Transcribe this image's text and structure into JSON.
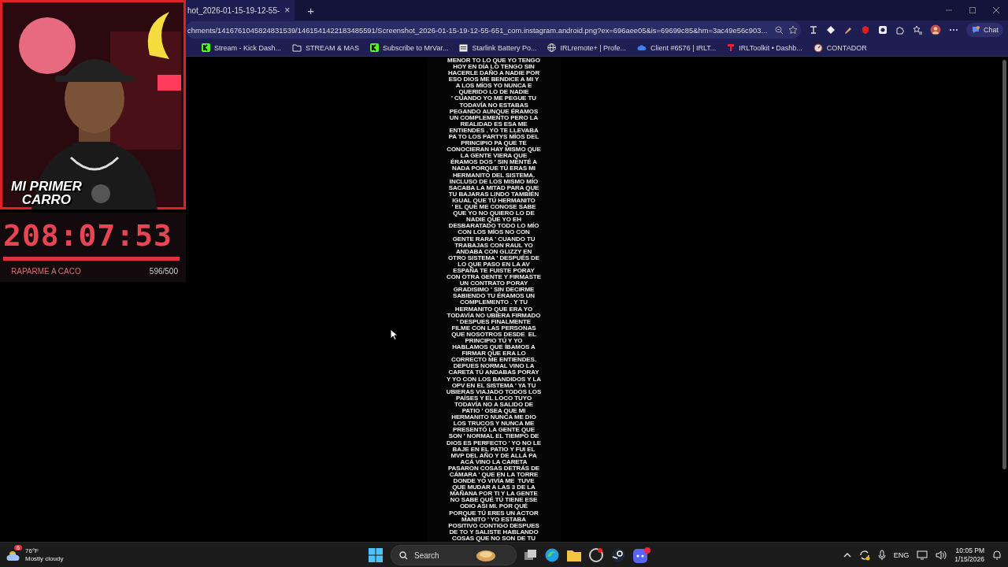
{
  "overlay": {
    "webcam": {
      "caption_lines": [
        "MI PRIMER",
        "CARRO"
      ]
    },
    "timer": {
      "time": "208:07:53",
      "level": 1,
      "goal_label": "RAPARME A CACO",
      "goal_count": "596/500"
    }
  },
  "browser": {
    "tabs": [
      {
        "title": "hot_2026-01-15-19-12-55-",
        "close": "×",
        "selected": true
      }
    ],
    "new_tab": "+",
    "address": "chments/1416761045824831539/1461541422183485591/Screenshot_2026-01-15-19-12-55-651_com.instagram.android.png?ex=696aee05&is=69699c85&hm=3ac49e56c903...",
    "chat_label": "Chat",
    "bookmarks": [
      {
        "label": "Stream - Kick Dash...",
        "kind": "kick"
      },
      {
        "label": "STREAM & MAS",
        "kind": "folder"
      },
      {
        "label": "Subscribe to MrVar...",
        "kind": "kick"
      },
      {
        "label": "Starlink Battery Po...",
        "kind": "page"
      },
      {
        "label": "IRLremote+ | Profe...",
        "kind": "globe"
      },
      {
        "label": "Client #6576 | IRLT...",
        "kind": "cloud"
      },
      {
        "label": "IRLToolkit • Dashb...",
        "kind": "toolkit"
      },
      {
        "label": "CONTADOR",
        "kind": "gauge"
      }
    ],
    "story_lines": [
      "MENOR TO LO QUE YO TENGO",
      "HOY EN DÍA LO TENGO SIN",
      "HACERLE DAÑO A NADIE POR",
      "ESO DIOS ME BENDICE A MI Y",
      "A LOS MÍOS YO NUNCA E",
      "QUERIDO LO DE NADIE",
      "' CUANDO YO ME PEGUE TU",
      "TODAVÍA NO ESTABAS",
      "PEGANDO AUNQUE ÉRAMOS",
      "UN COMPLEMENTO PERO LA",
      "REALIDAD ES ESA ME",
      "ENTIENDES . YO TE LLEVABA",
      "PA TO LOS PARTYS MÍOS DEL",
      "PRINCIPIO PA QUE TE",
      "CONOCIERAN HAY MISMO QUE",
      "LA GENTE VIERA QUE",
      "ÉRAMOS DOS ' SIN MENTÉ A",
      "NADA PORQUE TÚ ERAS MI",
      "HERMANITO DEL SISTEMA.",
      "INCLUSO DE LOS MISMO MÍO",
      "SACABA LA MITAD PARA QUE",
      "TU BAJARAS LINDO TAMBIÉN",
      "IGUAL QUE TÚ HERMANITO",
      "' EL QUE ME CONOSE SABE",
      "QUE YO NO QUIERO LO DE",
      "NADIE QUE YO EH",
      "DESBARATADO TODO LO MÍO",
      "CON LOS MÍOS NO CON",
      "GENTE RARA ' CUANDO TU",
      "TRABAJAS CON RAUL YO",
      "ANDABA CON GLIZZY EN",
      "OTRO SISTEMA ' DESPUÉS DE",
      "LO QUE PASO EN LA AV",
      "ESPAÑA TE FUISTE PORAY",
      "CON OTRA GENTE Y FIRMASTE",
      "UN CONTRATO PORAY",
      "GRADISIMO ' SIN DECIRME",
      "SABIENDO TU ÉRAMOS UN",
      "COMPLEMENTO . Y TU",
      "HERMANITO QUE ERA YO",
      "TODAVÍA NO UBIERA FIRMADO",
      "' DESPUES FINALMENTE",
      "FILME CON LAS PERSONAS",
      "QUE NOSOTROS DESDE  EL",
      "PRINCIPIO TÚ Y YO",
      "HABLAMOS QUE ÍBAMOS A",
      "FIRMAR QUE ERA LO",
      "CORRECTO ME ENTIENDES.",
      "DEPUES NORMAL VINO LA",
      "CARETA TÚ ANDABAS PORAY",
      "Y YO CON LOS BANDIDOS Y LA",
      "OPV EN EL SISTEMA ' YA TU",
      "UBIERAS VIAJADO TODOS LOS",
      "PAÍSES Y EL LOCO TUYO",
      "TODAVÍA NO A SALIDO DE",
      "PATIO ' OSEA QUE MI",
      "HERMANITO NUNCA ME DIO",
      "LOS TRUCOS Y NUNCA ME",
      "PRESENTÓ LA GENTE QUE",
      "SON ' NORMAL EL TIEMPO DE",
      "DIOS ES PERFECTO ' YO NO LE",
      "BAJE EN EL PATIO Y FUI EL",
      "MVP DEL AÑO Y DE ALLÁ PA",
      "ACÁ VINO LA CARETA",
      "PASARON COSAS DETRÁS DE",
      "CÁMARA ' QUE EN LA TORRE",
      "DONDE YO VIVÍA ME  TUVE",
      "QUE MUDAR A LAS 3 DE LA",
      "MAÑANA POR TI Y LA GENTE",
      "NO SABE QUÉ TÚ TIENE ESE",
      "ODIO ASI MI. POR QUÉ",
      "PORQUE TÚ ERES UN ACTOR",
      "MANITO ' YO ESTABA",
      "POSITIVO CONTIGO DESPUES",
      "DE TO Y SALISTE HABLANDO",
      "COSAS QUE NO SON DE TU"
    ]
  },
  "taskbar": {
    "weather_badge": "6",
    "temperature": "76°F",
    "condition": "Mostly cloudy",
    "search_placeholder": "Search",
    "language": "ENG",
    "time": "10:05 PM",
    "date": "1/15/2026"
  }
}
